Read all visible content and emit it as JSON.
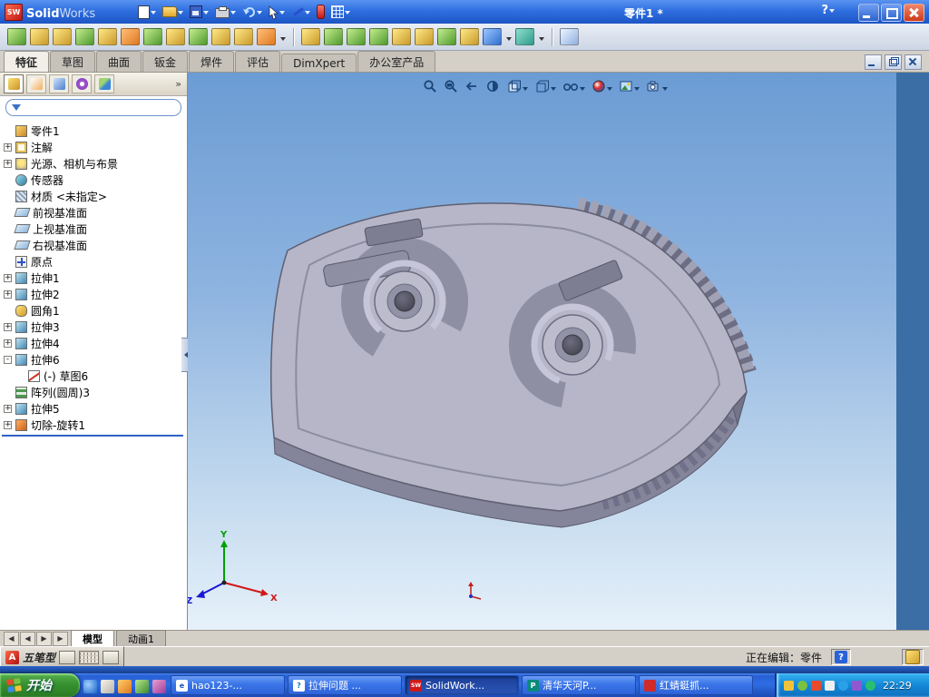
{
  "titlebar": {
    "logo_badge": "SW",
    "app_bold": "Solid",
    "app_light": "Works",
    "doc_title": "零件1 *",
    "help": "?"
  },
  "standard_toolbar": {
    "icons": [
      "new-document",
      "open",
      "save",
      "print",
      "undo",
      "select-cursor",
      "ink-sketch",
      "rebuild-stop",
      "view-grid"
    ]
  },
  "feature_toolbar": {
    "icons": [
      "extruded-boss",
      "revolved-boss",
      "swept-boss",
      "lofted-boss",
      "extruded-cut",
      "hole-wizard",
      "revolved-cut",
      "swept-cut",
      "lofted-cut",
      "fillet",
      "chamfer",
      "pattern",
      "linear-pattern",
      "circular-pattern",
      "mirror",
      "rib",
      "draft",
      "shell",
      "dome",
      "wrap",
      "reference-geometry",
      "curves",
      "sketch",
      "instant3d"
    ]
  },
  "command_tabs": {
    "tabs": [
      {
        "label": "特征",
        "active": true
      },
      {
        "label": "草图",
        "active": false
      },
      {
        "label": "曲面",
        "active": false
      },
      {
        "label": "钣金",
        "active": false
      },
      {
        "label": "焊件",
        "active": false
      },
      {
        "label": "评估",
        "active": false
      },
      {
        "label": "DimXpert",
        "active": false
      },
      {
        "label": "办公室产品",
        "active": false
      }
    ]
  },
  "featuremanager": {
    "pane_tabs": [
      "featuremanager",
      "propertymanager",
      "configurationmanager",
      "dimxpertmanager",
      "displaymanager"
    ],
    "overflow": "»",
    "filter_value": "",
    "root": "零件1",
    "items": [
      {
        "label": "注解",
        "exp": "+"
      },
      {
        "label": "光源、相机与布景",
        "exp": "+"
      },
      {
        "label": "传感器",
        "exp": ""
      },
      {
        "label": "材质 <未指定>",
        "exp": ""
      },
      {
        "label": "前视基准面",
        "exp": ""
      },
      {
        "label": "上视基准面",
        "exp": ""
      },
      {
        "label": "右视基准面",
        "exp": ""
      },
      {
        "label": "原点",
        "exp": ""
      },
      {
        "label": "拉伸1",
        "exp": "+"
      },
      {
        "label": "拉伸2",
        "exp": "+"
      },
      {
        "label": "圆角1",
        "exp": ""
      },
      {
        "label": "拉伸3",
        "exp": "+"
      },
      {
        "label": "拉伸4",
        "exp": "+"
      },
      {
        "label": "拉伸6",
        "exp": "-"
      },
      {
        "label": "(-) 草图6",
        "exp": ""
      },
      {
        "label": "阵列(圆周)3",
        "exp": ""
      },
      {
        "label": "拉伸5",
        "exp": "+"
      },
      {
        "label": "切除-旋转1",
        "exp": "+"
      }
    ]
  },
  "heads_up": {
    "icons": [
      "zoom-fit",
      "zoom-area",
      "previous-view",
      "section-view",
      "view-orientation",
      "display-style",
      "hide-show-items",
      "edit-appearance",
      "apply-scene",
      "camera-settings"
    ]
  },
  "task_pane": {
    "icons": [
      "solidworks-resources",
      "design-library",
      "file-explorer",
      "view-palette",
      "appearances-scenes",
      "custom-properties"
    ]
  },
  "viewport": {
    "triad": {
      "x": "X",
      "y": "Y",
      "z": "Z"
    }
  },
  "doc_tabs": {
    "nav": [
      "◀",
      "◀",
      "▶",
      "▶"
    ],
    "tabs": [
      {
        "label": "模型",
        "active": true
      },
      {
        "label": "动画1",
        "active": false
      }
    ]
  },
  "status_bar": {
    "editing_label": "正在编辑：零件",
    "help_symbol": "?"
  },
  "ime_bar": {
    "label": "五笔型"
  },
  "taskbar": {
    "start_label": "开始",
    "tasks": [
      {
        "label": "hao123-...",
        "icon_text": "e"
      },
      {
        "label": "拉伸问题 ...",
        "icon_text": "?"
      },
      {
        "label": "SolidWork...",
        "icon_text": "SW",
        "active": true
      },
      {
        "label": "清华天河P...",
        "icon_text": "P"
      },
      {
        "label": "红蜻蜓抓...",
        "icon_text": ""
      }
    ],
    "tray_time": "22:29"
  }
}
